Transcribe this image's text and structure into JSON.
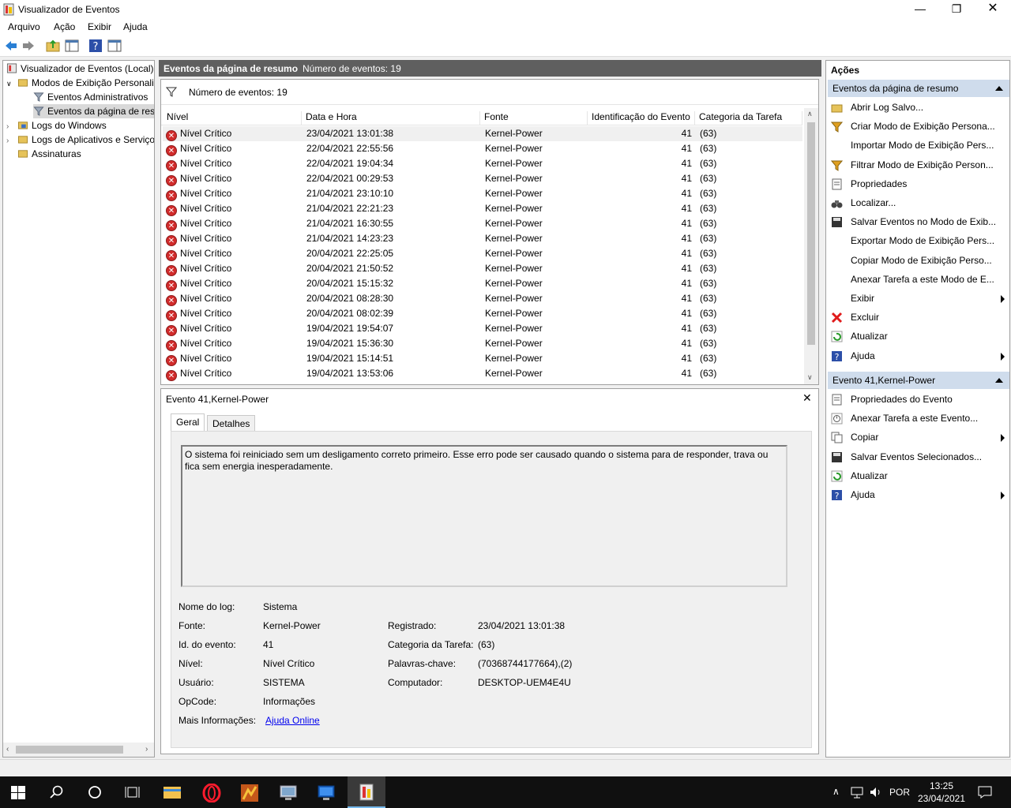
{
  "window": {
    "title": "Visualizador de Eventos"
  },
  "menu": [
    "Arquivo",
    "Ação",
    "Exibir",
    "Ajuda"
  ],
  "tree": {
    "root": "Visualizador de Eventos (Local)",
    "custom_views": "Modos de Exibição Personali",
    "admin_events": "Eventos Administrativos",
    "summary_events": "Eventos da página de res",
    "windows_logs": "Logs do Windows",
    "app_logs": "Logs de Aplicativos e Serviço",
    "subscriptions": "Assinaturas"
  },
  "middle": {
    "header_title": "Eventos da página de resumo",
    "header_count": "Número de eventos: 19",
    "filter_count": "Número de eventos: 19",
    "columns": [
      "Nível",
      "Data e Hora",
      "Fonte",
      "Identificação do Evento",
      "Categoria da Tarefa"
    ],
    "rows": [
      [
        "Nível Crítico",
        "23/04/2021 13:01:38",
        "Kernel-Power",
        "41",
        "(63)"
      ],
      [
        "Nível Crítico",
        "22/04/2021 22:55:56",
        "Kernel-Power",
        "41",
        "(63)"
      ],
      [
        "Nível Crítico",
        "22/04/2021 19:04:34",
        "Kernel-Power",
        "41",
        "(63)"
      ],
      [
        "Nível Crítico",
        "22/04/2021 00:29:53",
        "Kernel-Power",
        "41",
        "(63)"
      ],
      [
        "Nível Crítico",
        "21/04/2021 23:10:10",
        "Kernel-Power",
        "41",
        "(63)"
      ],
      [
        "Nível Crítico",
        "21/04/2021 22:21:23",
        "Kernel-Power",
        "41",
        "(63)"
      ],
      [
        "Nível Crítico",
        "21/04/2021 16:30:55",
        "Kernel-Power",
        "41",
        "(63)"
      ],
      [
        "Nível Crítico",
        "21/04/2021 14:23:23",
        "Kernel-Power",
        "41",
        "(63)"
      ],
      [
        "Nível Crítico",
        "20/04/2021 22:25:05",
        "Kernel-Power",
        "41",
        "(63)"
      ],
      [
        "Nível Crítico",
        "20/04/2021 21:50:52",
        "Kernel-Power",
        "41",
        "(63)"
      ],
      [
        "Nível Crítico",
        "20/04/2021 15:15:32",
        "Kernel-Power",
        "41",
        "(63)"
      ],
      [
        "Nível Crítico",
        "20/04/2021 08:28:30",
        "Kernel-Power",
        "41",
        "(63)"
      ],
      [
        "Nível Crítico",
        "20/04/2021 08:02:39",
        "Kernel-Power",
        "41",
        "(63)"
      ],
      [
        "Nível Crítico",
        "19/04/2021 19:54:07",
        "Kernel-Power",
        "41",
        "(63)"
      ],
      [
        "Nível Crítico",
        "19/04/2021 15:36:30",
        "Kernel-Power",
        "41",
        "(63)"
      ],
      [
        "Nível Crítico",
        "19/04/2021 15:14:51",
        "Kernel-Power",
        "41",
        "(63)"
      ],
      [
        "Nível Crítico",
        "19/04/2021 13:53:06",
        "Kernel-Power",
        "41",
        "(63)"
      ]
    ]
  },
  "details": {
    "title": "Evento 41,Kernel-Power",
    "tabs": [
      "Geral",
      "Detalhes"
    ],
    "description": "O sistema foi reiniciado sem um desligamento correto primeiro. Esse erro pode ser causado quando o sistema para de responder, trava ou fica sem energia inesperadamente.",
    "labels": {
      "log_name": "Nome do log:",
      "source": "Fonte:",
      "event_id": "Id. do evento:",
      "level": "Nível:",
      "user": "Usuário:",
      "opcode": "OpCode:",
      "more_info": "Mais Informações:",
      "logged": "Registrado:",
      "task_category": "Categoria da Tarefa:",
      "keywords": "Palavras-chave:",
      "computer": "Computador:"
    },
    "values": {
      "log_name": "Sistema",
      "source": "Kernel-Power",
      "event_id": "41",
      "level": "Nível Crítico",
      "user": "SISTEMA",
      "opcode": "Informações",
      "more_info": "Ajuda Online",
      "logged": "23/04/2021 13:01:38",
      "task_category": "(63)",
      "keywords": "(70368744177664),(2)",
      "computer": "DESKTOP-UEM4E4U"
    }
  },
  "actions": {
    "title": "Ações",
    "section1": "Eventos da página de resumo",
    "items1": [
      {
        "label": "Abrir Log Salvo...",
        "icon": "folder-icon",
        "arrow": false
      },
      {
        "label": "Criar Modo de Exibição Persona...",
        "icon": "filter-icon",
        "arrow": false
      },
      {
        "label": "Importar Modo de Exibição Pers...",
        "icon": "",
        "arrow": false
      },
      {
        "label": "Filtrar Modo de Exibição Person...",
        "icon": "filter-icon",
        "arrow": false
      },
      {
        "label": "Propriedades",
        "icon": "properties-icon",
        "arrow": false
      },
      {
        "label": "Localizar...",
        "icon": "binoculars-icon",
        "arrow": false
      },
      {
        "label": "Salvar Eventos no Modo de Exib...",
        "icon": "save-icon",
        "arrow": false
      },
      {
        "label": "Exportar Modo de Exibição Pers...",
        "icon": "",
        "arrow": false
      },
      {
        "label": "Copiar Modo de Exibição Perso...",
        "icon": "",
        "arrow": false
      },
      {
        "label": "Anexar Tarefa a este Modo de E...",
        "icon": "",
        "arrow": false
      },
      {
        "label": "Exibir",
        "icon": "",
        "arrow": true
      },
      {
        "label": "Excluir",
        "icon": "delete-icon",
        "arrow": false
      },
      {
        "label": "Atualizar",
        "icon": "refresh-icon",
        "arrow": false
      },
      {
        "label": "Ajuda",
        "icon": "help-icon",
        "arrow": true
      }
    ],
    "section2": "Evento 41,Kernel-Power",
    "items2": [
      {
        "label": "Propriedades do Evento",
        "icon": "properties-icon",
        "arrow": false
      },
      {
        "label": "Anexar Tarefa a este Evento...",
        "icon": "task-icon",
        "arrow": false
      },
      {
        "label": "Copiar",
        "icon": "copy-icon",
        "arrow": true
      },
      {
        "label": "Salvar Eventos Selecionados...",
        "icon": "save-icon",
        "arrow": false
      },
      {
        "label": "Atualizar",
        "icon": "refresh-icon",
        "arrow": false
      },
      {
        "label": "Ajuda",
        "icon": "help-icon",
        "arrow": true
      }
    ]
  },
  "taskbar": {
    "lang": "POR",
    "time": "13:25",
    "date": "23/04/2021"
  }
}
